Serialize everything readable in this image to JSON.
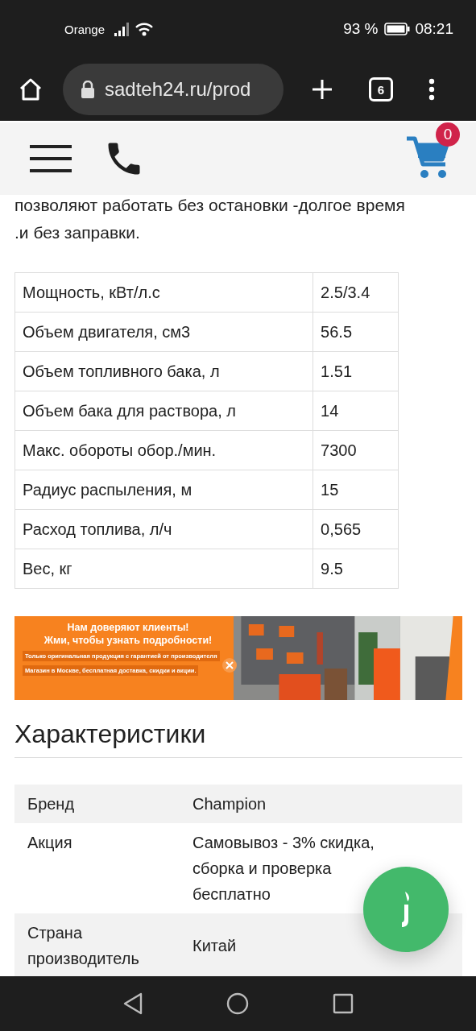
{
  "status_bar": {
    "carrier": "Orange",
    "battery": "93 %",
    "time": "08:21"
  },
  "browser": {
    "url": "sadteh24.ru/prod",
    "tab_count": "6"
  },
  "site_header": {
    "cart_count": "0"
  },
  "intro_text": "позволяют работать без остановки -долгое время\n.и без заправки.",
  "specs_table": [
    {
      "label": "Мощность, кВт/л.с",
      "value": "2.5/3.4"
    },
    {
      "label": "Объем двигателя, см3",
      "value": "56.5"
    },
    {
      "label": "Объем топливного бака, л",
      "value": "1.51"
    },
    {
      "label": "Объем бака для раствора, л",
      "value": "14"
    },
    {
      "label": "Макс. обороты обор./мин.",
      "value": "7300"
    },
    {
      "label": "Радиус распыления, м",
      "value": "15"
    },
    {
      "label": "Расход топлива, л/ч",
      "value": "0,565"
    },
    {
      "label": "Вес, кг",
      "value": "9.5"
    }
  ],
  "banner": {
    "title": "Нам доверяют клиенты!\nЖми, чтобы узнать подробности!",
    "lines": [
      "Только оригинальная продукция с гарантией от производителя",
      "Магазин в Москве, бесплатная доставка, скидки и акции."
    ]
  },
  "characteristics": {
    "heading": "Характеристики",
    "rows": [
      {
        "label": "Бренд",
        "value": "Champion"
      },
      {
        "label": "Акция",
        "value": "Самовывоз - 3% скидка, сборка и проверка бесплатно"
      },
      {
        "label": "Страна производитель",
        "value": "Китай"
      }
    ]
  }
}
